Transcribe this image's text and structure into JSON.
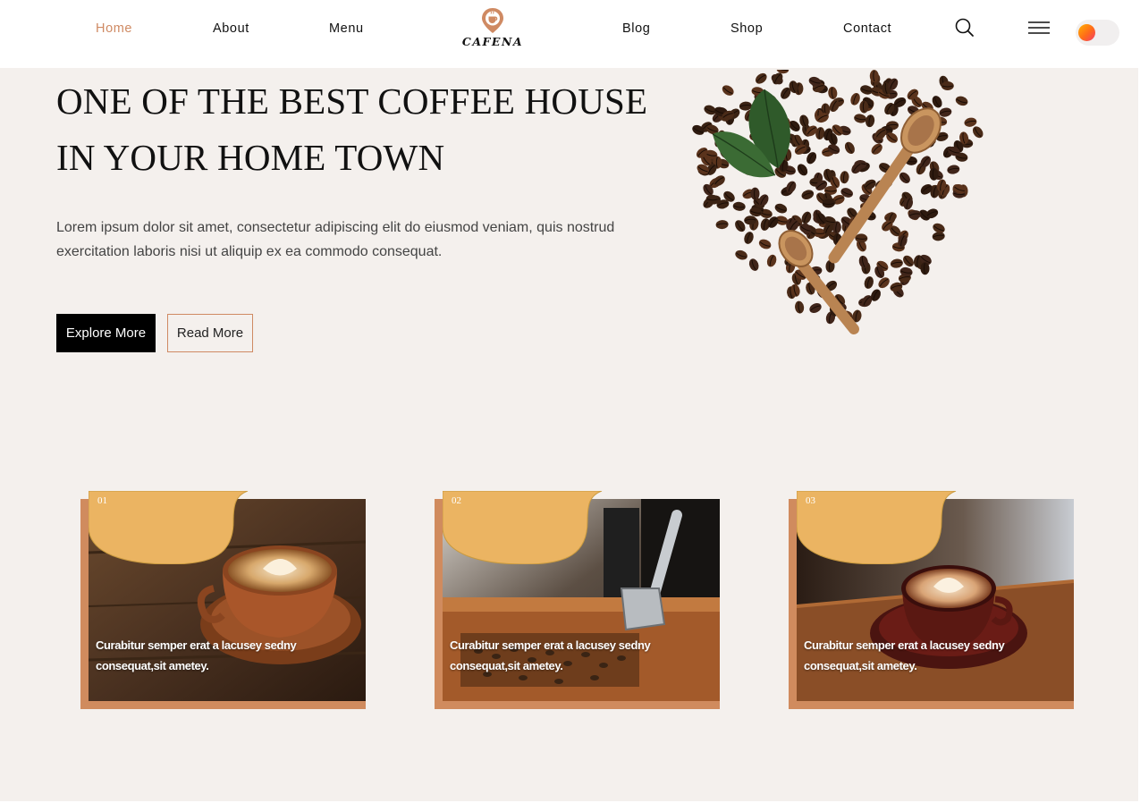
{
  "header": {
    "nav_left": [
      "Home",
      "About",
      "Menu"
    ],
    "nav_right": [
      "Blog",
      "Shop",
      "Contact"
    ],
    "logo_text": "CAFENA",
    "icons": {
      "search": "search-icon",
      "menu": "hamburger-menu-icon",
      "logo": "coffee-pin-icon"
    },
    "theme_toggle_state": "off"
  },
  "hero": {
    "title_line1": "ONE OF THE BEST COFFEE HOUSE",
    "title_line2": "IN YOUR HOME TOWN",
    "description": "Lorem ipsum dolor sit amet, consectetur adipiscing elit do eiusmod veniam, quis nostrud exercitation laboris nisi ut aliquip ex ea commodo consequat.",
    "explore_label": "Explore More",
    "read_label": "Read More"
  },
  "cards": [
    {
      "number": "01",
      "text": "Curabitur semper erat a lacusey sedny consequat,sit ametey."
    },
    {
      "number": "02",
      "text": "Curabitur semper erat a lacusey sedny consequat,sit ametey."
    },
    {
      "number": "03",
      "text": "Curabitur semper erat a lacusey sedny consequat,sit ametey."
    }
  ],
  "colors": {
    "accent": "#cf8a63",
    "card_tab": "#ebb462",
    "card_frame": "#d08b5e",
    "background": "#f4f0ed"
  }
}
